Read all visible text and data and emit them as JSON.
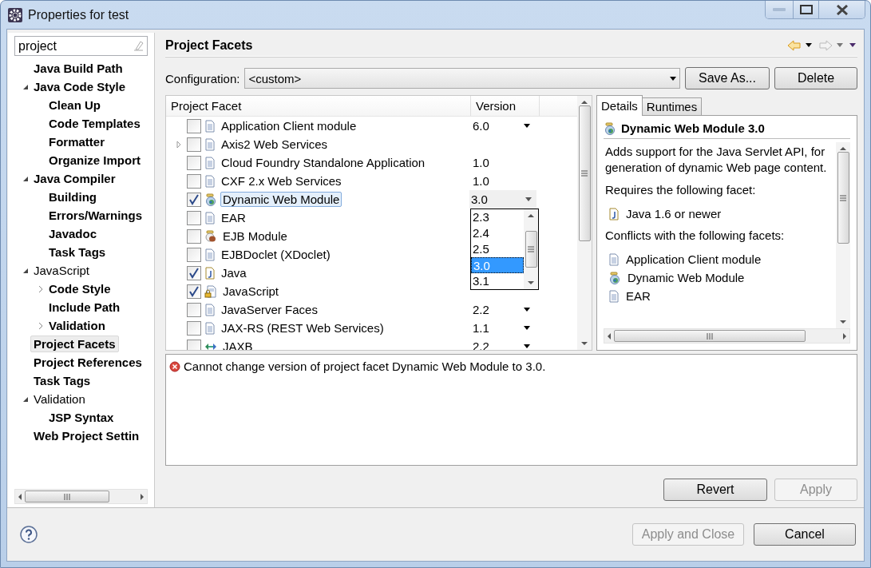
{
  "window": {
    "title": "Properties for test"
  },
  "filter": {
    "value": "project"
  },
  "tree": [
    {
      "label": "Java Build Path",
      "bold": true,
      "selected": false
    },
    {
      "label": "Java Code Style",
      "bold": true,
      "selected": false,
      "expanded": true,
      "children": [
        {
          "label": "Clean Up",
          "bold": true,
          "selected": false
        },
        {
          "label": "Code Templates",
          "bold": true,
          "selected": false
        },
        {
          "label": "Formatter",
          "bold": true,
          "selected": false
        },
        {
          "label": "Organize Import",
          "bold": true,
          "selected": false
        }
      ]
    },
    {
      "label": "Java Compiler",
      "bold": true,
      "selected": false,
      "expanded": true,
      "children": [
        {
          "label": "Building",
          "bold": true,
          "selected": false
        },
        {
          "label": "Errors/Warnings",
          "bold": true,
          "selected": false
        },
        {
          "label": "Javadoc",
          "bold": true,
          "selected": false
        },
        {
          "label": "Task Tags",
          "bold": true,
          "selected": false
        }
      ]
    },
    {
      "label": "JavaScript",
      "bold": false,
      "selected": false,
      "expanded": true,
      "children": [
        {
          "label": "Code Style",
          "bold": true,
          "selected": false,
          "expanded": false
        },
        {
          "label": "Include Path",
          "bold": true,
          "selected": false
        },
        {
          "label": "Validation",
          "bold": true,
          "selected": false,
          "expanded": false
        }
      ]
    },
    {
      "label": "Project Facets",
      "bold": true,
      "selected": true
    },
    {
      "label": "Project References",
      "bold": true,
      "selected": false
    },
    {
      "label": "Task Tags",
      "bold": true,
      "selected": false
    },
    {
      "label": "Validation",
      "bold": false,
      "selected": false,
      "expanded": true,
      "children": [
        {
          "label": "JSP Syntax",
          "bold": true,
          "selected": false
        }
      ]
    },
    {
      "label": "Web Project Settin",
      "bold": true,
      "selected": false
    }
  ],
  "page": {
    "title": "Project Facets",
    "back_enabled": true,
    "forward_enabled": false
  },
  "configuration": {
    "label": "Configuration:",
    "value": "<custom>",
    "buttons": [
      {
        "label": "Save As..."
      },
      {
        "label": "Delete"
      }
    ]
  },
  "facets": {
    "columns": [
      "Project Facet",
      "Version"
    ],
    "rows": [
      {
        "name": "Application Client module",
        "kind": "document",
        "checked": false,
        "selected": false,
        "version": "6.0",
        "choices": true
      },
      {
        "name": "Axis2 Web Services",
        "kind": "document",
        "checked": false,
        "selected": false,
        "expanded": false
      },
      {
        "name": "Cloud Foundry Standalone Application",
        "kind": "document",
        "checked": false,
        "selected": false,
        "version": "1.0",
        "choices": false
      },
      {
        "name": "CXF 2.x Web Services",
        "kind": "document",
        "checked": false,
        "selected": false,
        "version": "1.0",
        "choices": false
      },
      {
        "name": "Dynamic Web Module",
        "kind": "web",
        "checked": true,
        "selected": true,
        "version": "3.0",
        "choices": true,
        "editing": true
      },
      {
        "name": "EAR",
        "kind": "document",
        "checked": false,
        "selected": false
      },
      {
        "name": "EJB Module",
        "kind": "bean",
        "checked": false,
        "selected": false
      },
      {
        "name": "EJBDoclet (XDoclet)",
        "kind": "document",
        "checked": false,
        "selected": false
      },
      {
        "name": "Java",
        "kind": "java",
        "checked": true,
        "selected": false
      },
      {
        "name": "JavaScript",
        "kind": "script",
        "checked": true,
        "selected": false
      },
      {
        "name": "JavaServer Faces",
        "kind": "document",
        "checked": false,
        "selected": false,
        "version": "2.2",
        "choices": true
      },
      {
        "name": "JAX-RS (REST Web Services)",
        "kind": "document",
        "checked": false,
        "selected": false,
        "version": "1.1",
        "choices": true
      },
      {
        "name": "JAXB",
        "kind": "binding",
        "checked": false,
        "selected": false,
        "version": "2.2",
        "choices": true
      }
    ],
    "version_list": [
      {
        "label": "2.3",
        "selected": false
      },
      {
        "label": "2.4",
        "selected": false
      },
      {
        "label": "2.5",
        "selected": false
      },
      {
        "label": "3.0",
        "selected": true
      },
      {
        "label": "3.1",
        "selected": false
      }
    ]
  },
  "details": {
    "tabs": [
      {
        "label": "Details",
        "selected": true
      },
      {
        "label": "Runtimes",
        "selected": false
      }
    ],
    "heading": "Dynamic Web Module 3.0",
    "description": "Adds support for the Java Servlet API, for generation of dynamic Web page content.",
    "requires_label": "Requires the following facet:",
    "requires": [
      {
        "label": "Java 1.6 or newer",
        "kind": "java"
      }
    ],
    "conflicts_label": "Conflicts with the following facets:",
    "conflicts": [
      {
        "label": "Application Client module",
        "kind": "document"
      },
      {
        "label": "Dynamic Web Module",
        "kind": "web"
      },
      {
        "label": "EAR",
        "kind": "document"
      }
    ]
  },
  "message": {
    "kind": "error",
    "text": "Cannot change version of project facet Dynamic Web Module to 3.0."
  },
  "actions": [
    {
      "label": "Revert",
      "disabled": false
    },
    {
      "label": "Apply",
      "disabled": true
    }
  ],
  "footer": [
    {
      "label": "Apply and Close",
      "disabled": true
    },
    {
      "label": "Cancel",
      "disabled": false
    }
  ]
}
